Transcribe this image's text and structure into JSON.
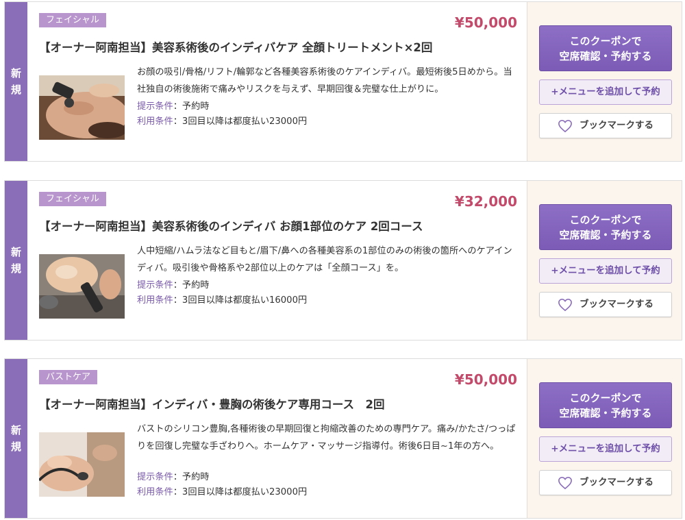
{
  "coupons": [
    {
      "new_label": "新規",
      "category": "フェイシャル",
      "price": "¥50,000",
      "title": "【オーナー阿南担当】美容系術後のインディバケア 全顔トリートメント×2回",
      "desc": "お顔の吸引/骨格/リフト/輪郭など各種美容系術後のケアインディバ。最短術後5日めから。当社独自の術後施術で痛みやリスクを与えず、早期回復＆完璧な仕上がりに。",
      "cond1_label": "提示条件",
      "cond1_value": "：予約時",
      "cond2_label": "利用条件",
      "cond2_value": "：3回目以降は都度払い23000円",
      "btn_coupon_line1": "このクーポンで",
      "btn_coupon_line2": "空席確認・予約する",
      "btn_menu": "+メニューを追加して予約",
      "btn_bookmark": "ブックマークする"
    },
    {
      "new_label": "新規",
      "category": "フェイシャル",
      "price": "¥32,000",
      "title": "【オーナー阿南担当】美容系術後のインディバ お顔1部位のケア 2回コース",
      "desc": "人中短縮/ハムラ法など目もと/眉下/鼻への各種美容系の1部位のみの術後の箇所へのケアインディバ。吸引後や骨格系や2部位以上のケアは「全顔コース」を。",
      "cond1_label": "提示条件",
      "cond1_value": "：予約時",
      "cond2_label": "利用条件",
      "cond2_value": "：3回目以降は都度払い16000円",
      "btn_coupon_line1": "このクーポンで",
      "btn_coupon_line2": "空席確認・予約する",
      "btn_menu": "+メニューを追加して予約",
      "btn_bookmark": "ブックマークする"
    },
    {
      "new_label": "新規",
      "category": "バストケア",
      "price": "¥50,000",
      "title": "【オーナー阿南担当】インディバ・豊胸の術後ケア専用コース　2回",
      "desc": "バストのシリコン豊胸,各種術後の早期回復と拘縮改善のための専門ケア。痛み/かたさ/つっぱりを回復し完璧な手ざわりへ。ホームケア・マッサージ指導付。術後6日目~1年の方へ。",
      "cond1_label": "提示条件",
      "cond1_value": "：予約時",
      "cond2_label": "利用条件",
      "cond2_value": "：3回目以降は都度払い23000円",
      "btn_coupon_line1": "このクーポンで",
      "btn_coupon_line2": "空席確認・予約する",
      "btn_menu": "+メニューを追加して予約",
      "btn_bookmark": "ブックマークする"
    }
  ],
  "colors": {
    "new_strip": "#8b6eb8",
    "category_tag": "#b995cd",
    "price": "#c24a6a",
    "primary_button": "#7b5bb5",
    "side_panel": "#fbf5ee"
  },
  "icons": {
    "bookmark": "heart-outline-icon"
  }
}
